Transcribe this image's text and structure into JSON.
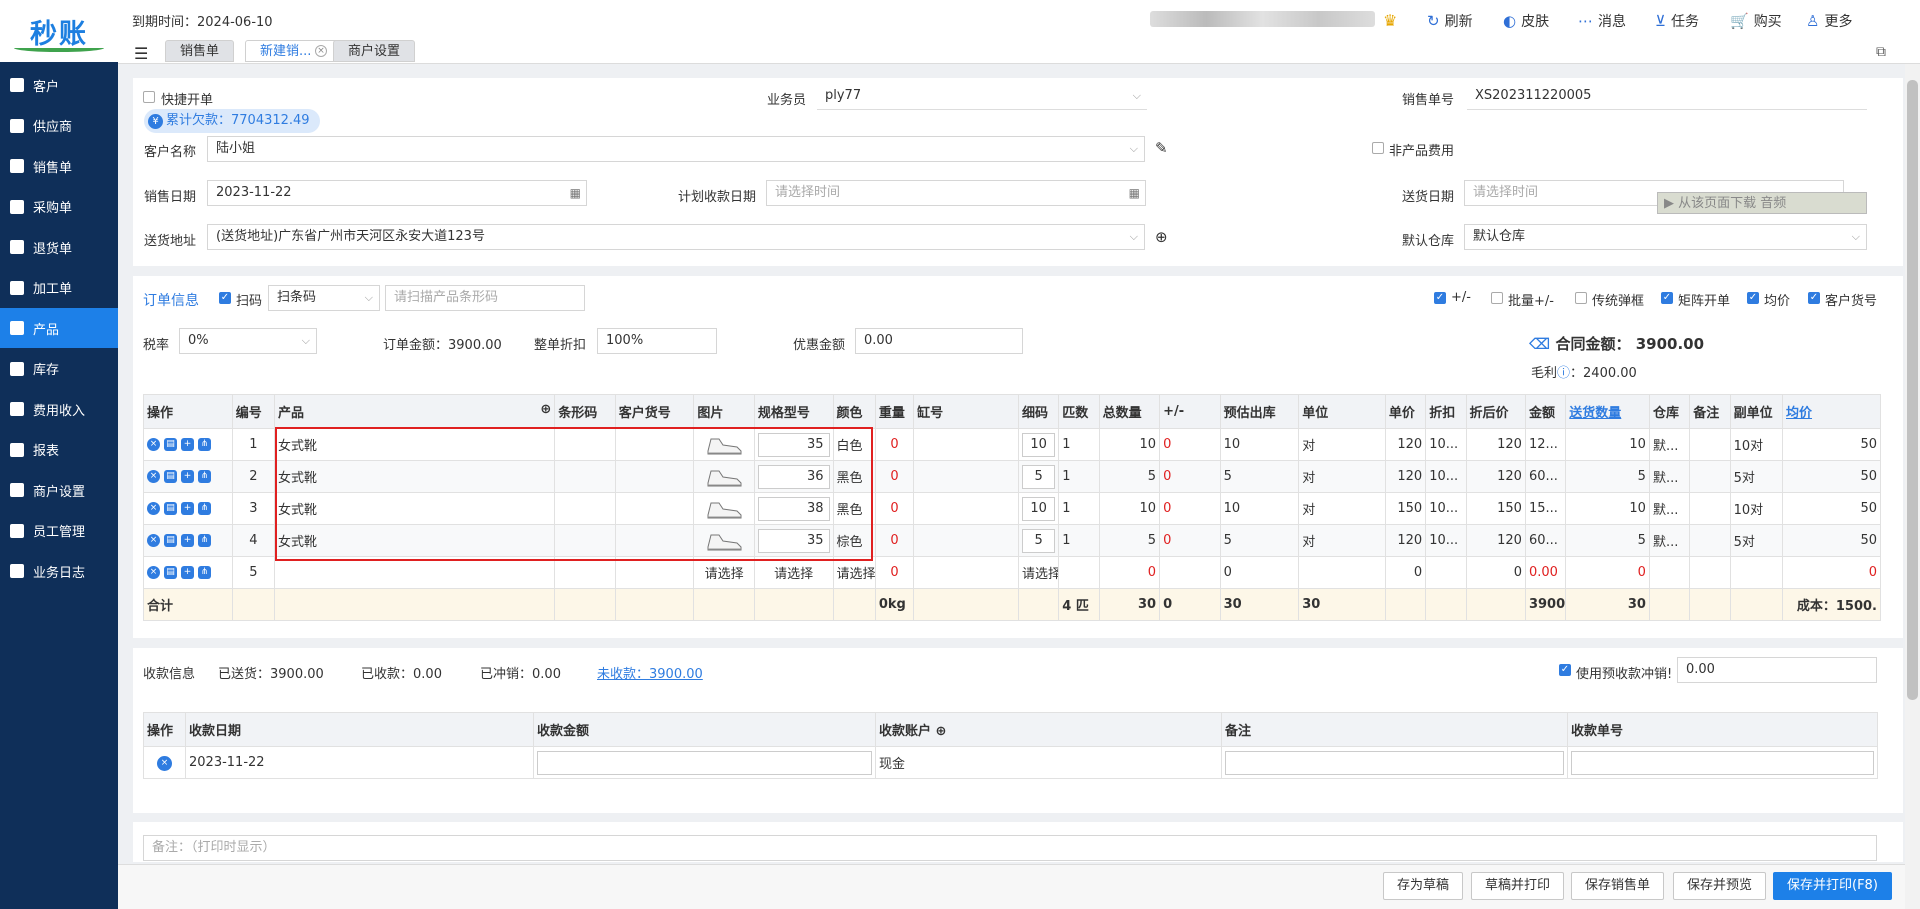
{
  "app": {
    "logo": "秒账",
    "expire": "到期时间：2024-06-10"
  },
  "toolbar": {
    "refresh": "刷新",
    "skin": "皮肤",
    "msg": "消息",
    "task": "任务",
    "buy": "购买",
    "more": "更多"
  },
  "tabs": [
    "销售单",
    "新建销...",
    "商户设置"
  ],
  "nav": [
    "客户",
    "供应商",
    "销售单",
    "采购单",
    "退货单",
    "加工单",
    "产品",
    "库存",
    "费用收入",
    "报表",
    "商户设置",
    "员工管理",
    "业务日志"
  ],
  "form": {
    "quick": "快捷开单",
    "salesman_label": "业务员",
    "salesman": "ply77",
    "order_no_label": "销售单号",
    "order_no": "XS202311220005",
    "debt": "累计欠款：7704312.49",
    "customer_label": "客户名称",
    "customer": "陆小姐",
    "nonproduct": "非产品费用",
    "date_label": "销售日期",
    "date": "2023-11-22",
    "plan_label": "计划收款日期",
    "plan_ph": "请选择时间",
    "ship_label": "送货日期",
    "ship_ph": "请选择时间",
    "download": "从该页面下载 音频",
    "addr_label": "送货地址",
    "addr": "(送货地址)广东省广州市天河区永安大道123号",
    "wh_label": "默认仓库",
    "wh": "默认仓库"
  },
  "order": {
    "title": "订单信息",
    "scan": "扫码",
    "scan_mode": "扫条码",
    "scan_ph": "请扫描产品条形码",
    "opts": [
      "+/-",
      "批量+/-",
      "传统弹框",
      "矩阵开单",
      "均价",
      "客户货号"
    ],
    "tax_label": "税率",
    "tax": "0%",
    "amount": "订单金额：3900.00",
    "discount_label": "整单折扣",
    "discount": "100%",
    "coupon_label": "优惠金额",
    "coupon": "0.00",
    "contract_label": "合同金额：",
    "contract": "3900.00",
    "profit_label": "毛利",
    "profit": "：2400.00"
  },
  "table": {
    "headers": [
      "操作",
      "编号",
      "产品",
      "条形码",
      "客户货号",
      "图片",
      "规格型号",
      "颜色",
      "重量",
      "缸号",
      "细码",
      "匹数",
      "总数量",
      "+/-",
      "预估出库",
      "单位",
      "单价",
      "折扣",
      "折后价",
      "金额",
      "送货数量",
      "仓库",
      "备注",
      "副单位",
      "均价"
    ],
    "rows": [
      {
        "no": "1",
        "product": "女式靴",
        "size": "35",
        "color": "白色",
        "weight": "0",
        "code": "10",
        "pieces": "1",
        "qty": "10",
        "pm": "0",
        "est": "10",
        "unit": "对",
        "price": "120",
        "disc": "10...",
        "after": "120",
        "amt": "12...",
        "deliver": "10",
        "wh": "默...",
        "sub": "10对",
        "avg": "50"
      },
      {
        "no": "2",
        "product": "女式靴",
        "size": "36",
        "color": "黑色",
        "weight": "0",
        "code": "5",
        "pieces": "1",
        "qty": "5",
        "pm": "0",
        "est": "5",
        "unit": "对",
        "price": "120",
        "disc": "10...",
        "after": "120",
        "amt": "60...",
        "deliver": "5",
        "wh": "默...",
        "sub": "5对",
        "avg": "50"
      },
      {
        "no": "3",
        "product": "女式靴",
        "size": "38",
        "color": "黑色",
        "weight": "0",
        "code": "10",
        "pieces": "1",
        "qty": "10",
        "pm": "0",
        "est": "10",
        "unit": "对",
        "price": "150",
        "disc": "10...",
        "after": "150",
        "amt": "15...",
        "deliver": "10",
        "wh": "默...",
        "sub": "10对",
        "avg": "50"
      },
      {
        "no": "4",
        "product": "女式靴",
        "size": "35",
        "color": "棕色",
        "weight": "0",
        "code": "5",
        "pieces": "1",
        "qty": "5",
        "pm": "0",
        "est": "5",
        "unit": "对",
        "price": "120",
        "disc": "10...",
        "after": "120",
        "amt": "60...",
        "deliver": "5",
        "wh": "默...",
        "sub": "5对",
        "avg": "50"
      }
    ],
    "new_row": {
      "no": "5",
      "select": "请选择",
      "weight": "0",
      "qty": "0",
      "est": "0",
      "price": "0",
      "after": "0",
      "amt": "0.00",
      "deliver": "0",
      "avg": "0"
    },
    "total": {
      "label": "合计",
      "weight": "0kg",
      "pieces": "4 匹",
      "qty": "30",
      "pm": "0",
      "est": "30",
      "unit": "30",
      "amt": "3900",
      "deliver": "30",
      "cost": "成本：1500."
    }
  },
  "payment": {
    "title": "收款信息",
    "sent": "已送货：",
    "sent_v": "3900.00",
    "received": "已收款：",
    "received_v": "0.00",
    "offset": "已冲销：",
    "offset_v": "0.00",
    "unpaid": "未收款：",
    "unpaid_v": "3900.00",
    "prepay": "使用预收款冲销!",
    "prepay_v": "0.00",
    "headers": [
      "操作",
      "收款日期",
      "收款金额",
      "收款账户",
      "备注",
      "收款单号"
    ],
    "row": {
      "date": "2023-11-22",
      "account": "现金"
    }
  },
  "remark": "备注：（打印时显示）",
  "buttons": [
    "存为草稿",
    "草稿并打印",
    "保存销售单",
    "保存并预览",
    "保存并打印(F8)"
  ]
}
